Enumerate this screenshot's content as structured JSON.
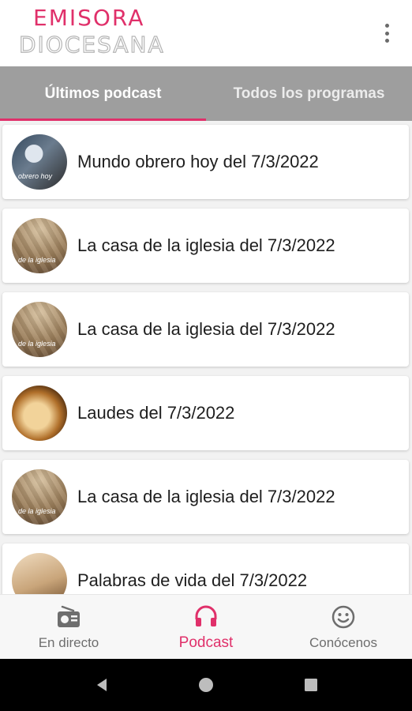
{
  "app": {
    "logo_line1": "EMISORA",
    "logo_line2": "DIOCESANA",
    "accent_color": "#e0306a"
  },
  "tabs": [
    {
      "label": "Últimos podcast",
      "active": true
    },
    {
      "label": "Todos los programas",
      "active": false
    }
  ],
  "podcasts": [
    {
      "title": "Mundo obrero hoy del 7/3/2022",
      "thumb_caption": "obrero hoy",
      "icon": "mundo-obrero-thumbnail"
    },
    {
      "title": "La casa de la iglesia del 7/3/2022",
      "thumb_caption": "de la iglesia",
      "icon": "casa-iglesia-thumbnail"
    },
    {
      "title": "La casa de la iglesia del 7/3/2022",
      "thumb_caption": "de la iglesia",
      "icon": "casa-iglesia-thumbnail"
    },
    {
      "title": "Laudes del 7/3/2022",
      "thumb_caption": "",
      "icon": "laudes-thumbnail"
    },
    {
      "title": "La casa de la iglesia del 7/3/2022",
      "thumb_caption": "de la iglesia",
      "icon": "casa-iglesia-thumbnail"
    },
    {
      "title": "Palabras de vida del 7/3/2022",
      "thumb_caption": "",
      "icon": "palabras-vida-thumbnail"
    }
  ],
  "bottom_nav": [
    {
      "label": "En directo",
      "icon": "radio-icon",
      "active": false
    },
    {
      "label": "Podcast",
      "icon": "headphones-icon",
      "active": true
    },
    {
      "label": "Conócenos",
      "icon": "smiley-icon",
      "active": false
    }
  ]
}
